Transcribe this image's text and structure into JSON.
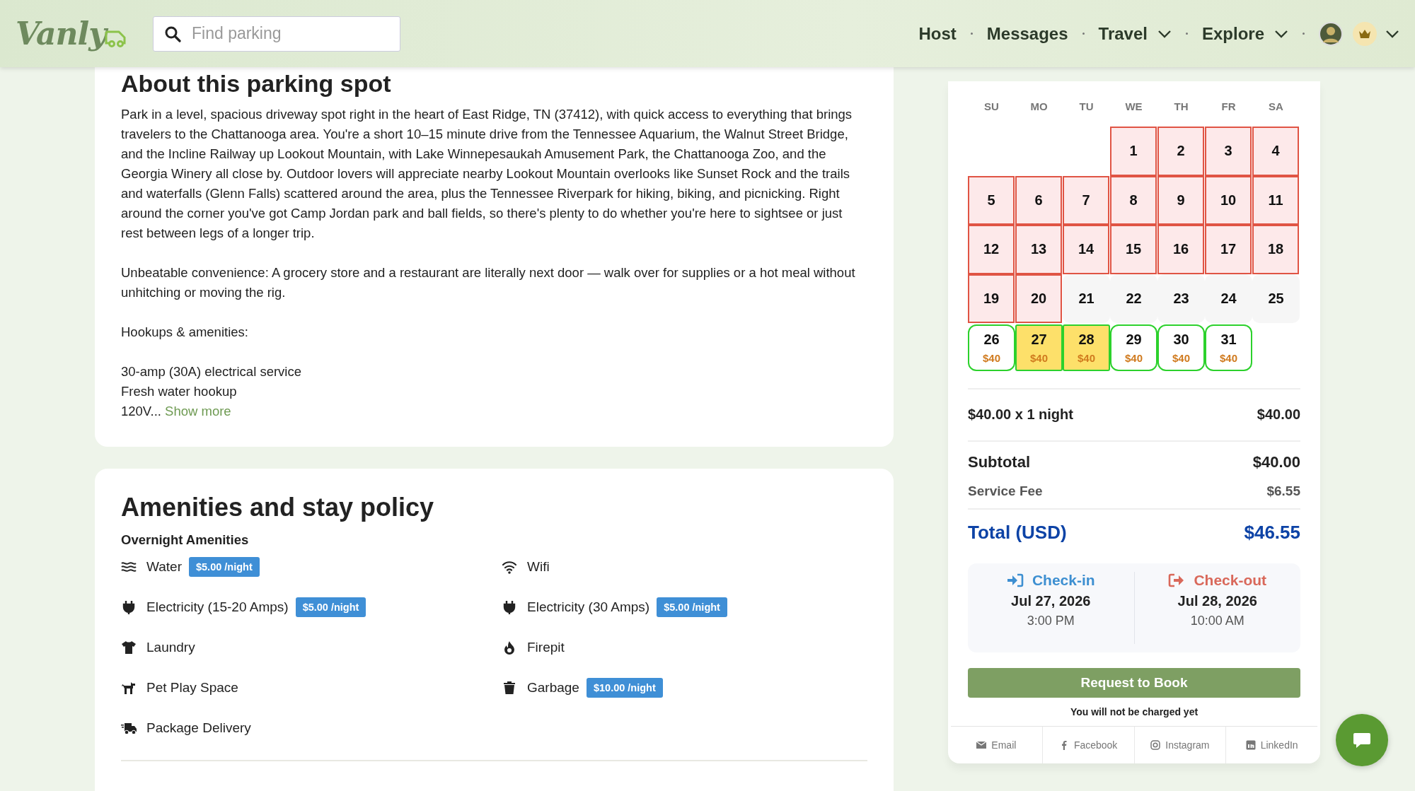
{
  "header": {
    "logo": "Vanly",
    "search": {
      "placeholder": "Find parking"
    },
    "nav": [
      {
        "label": "Host",
        "dropdown": false
      },
      {
        "label": "Messages",
        "dropdown": false
      },
      {
        "label": "Travel",
        "dropdown": true
      },
      {
        "label": "Explore",
        "dropdown": true
      }
    ]
  },
  "about": {
    "title": "About this parking spot",
    "paragraphs": [
      "Park in a level, spacious driveway spot right in the heart of East Ridge, TN (37412), with quick access to everything that brings travelers to the Chattanooga area. You're a short 10–15 minute drive from the Tennessee Aquarium, the Walnut Street Bridge, and the Incline Railway up Lookout Mountain, with Lake Winnepesaukah Amusement Park, the Chattanooga Zoo, and the Georgia Winery all close by. Outdoor lovers will appreciate nearby Lookout Mountain overlooks like Sunset Rock and the trails and waterfalls (Glenn Falls) scattered around the area, plus the Tennessee Riverpark for hiking, biking, and picnicking. Right around the corner you've got Camp Jordan park and ball fields, so there's plenty to do whether you're here to sightsee or just rest between legs of a longer trip.",
      "Unbeatable convenience: A grocery store and a restaurant are literally next door — walk over for supplies or a hot meal without unhitching or moving the rig.",
      "Hookups & amenities:"
    ],
    "list_lines": [
      "30-amp (30A) electrical service",
      "Fresh water hookup"
    ],
    "last_line": "120V...",
    "show_more": "Show more"
  },
  "amenities": {
    "title": "Amenities and stay policy",
    "section": "Overnight Amenities",
    "items": [
      {
        "kind": "water",
        "label": "Water",
        "fee": "$5.00 /night"
      },
      {
        "kind": "wifi",
        "label": "Wifi"
      },
      {
        "kind": "electricity",
        "label": "Electricity (15-20 Amps)",
        "fee": "$5.00 /night"
      },
      {
        "kind": "electricity",
        "label": "Electricity (30 Amps)",
        "fee": "$5.00 /night"
      },
      {
        "kind": "laundry",
        "label": "Laundry"
      },
      {
        "kind": "firepit",
        "label": "Firepit"
      },
      {
        "kind": "pets",
        "label": "Pet Play Space"
      },
      {
        "kind": "garbage",
        "label": "Garbage",
        "fee": "$10.00 /night"
      },
      {
        "kind": "delivery",
        "label": "Package Delivery"
      }
    ]
  },
  "booking": {
    "weekdays": [
      "SU",
      "MO",
      "TU",
      "WE",
      "TH",
      "FR",
      "SA"
    ],
    "days": [
      {
        "kind": "blank"
      },
      {
        "kind": "blank"
      },
      {
        "kind": "blank"
      },
      {
        "day": "1",
        "kind": "blocked",
        "selected": false
      },
      {
        "day": "2",
        "kind": "blocked",
        "selected": false
      },
      {
        "day": "3",
        "kind": "blocked",
        "selected": false
      },
      {
        "day": "4",
        "kind": "blocked",
        "selected": false
      },
      {
        "day": "5",
        "kind": "blocked",
        "selected": false
      },
      {
        "day": "6",
        "kind": "blocked",
        "selected": false
      },
      {
        "day": "7",
        "kind": "blocked",
        "selected": false
      },
      {
        "day": "8",
        "kind": "blocked",
        "selected": false
      },
      {
        "day": "9",
        "kind": "blocked",
        "selected": false
      },
      {
        "day": "10",
        "kind": "blocked",
        "selected": false
      },
      {
        "day": "11",
        "kind": "blocked",
        "selected": false
      },
      {
        "day": "12",
        "kind": "blocked",
        "selected": false
      },
      {
        "day": "13",
        "kind": "blocked",
        "selected": false
      },
      {
        "day": "14",
        "kind": "blocked",
        "selected": false
      },
      {
        "day": "15",
        "kind": "blocked",
        "selected": false
      },
      {
        "day": "16",
        "kind": "blocked",
        "selected": false
      },
      {
        "day": "17",
        "kind": "blocked",
        "selected": false
      },
      {
        "day": "18",
        "kind": "blocked",
        "selected": false
      },
      {
        "day": "19",
        "kind": "blocked",
        "selected": false
      },
      {
        "day": "20",
        "kind": "blocked",
        "selected": false
      },
      {
        "day": "21",
        "kind": "unavailable",
        "selected": false
      },
      {
        "day": "22",
        "kind": "unavailable",
        "selected": false
      },
      {
        "day": "23",
        "kind": "unavailable",
        "selected": false
      },
      {
        "day": "24",
        "kind": "unavailable",
        "selected": false
      },
      {
        "day": "25",
        "kind": "unavailable",
        "selected": false
      },
      {
        "day": "26",
        "kind": "available",
        "selected": false,
        "price": "$40"
      },
      {
        "day": "27",
        "kind": "available",
        "selected": true,
        "price": "$40"
      },
      {
        "day": "28",
        "kind": "available",
        "selected": true,
        "price": "$40"
      },
      {
        "day": "29",
        "kind": "available",
        "selected": false,
        "price": "$40"
      },
      {
        "day": "30",
        "kind": "available",
        "selected": false,
        "price": "$40"
      },
      {
        "day": "31",
        "kind": "available",
        "selected": false,
        "price": "$40"
      }
    ],
    "price_lines": [
      {
        "kind": "line",
        "label": "$40.00 x 1 night",
        "amount": "$40.00"
      },
      {
        "kind": "subtotal",
        "label": "Subtotal",
        "amount": "$40.00"
      },
      {
        "kind": "fee",
        "label": "Service Fee",
        "amount": "$6.55"
      },
      {
        "kind": "total",
        "label": "Total (USD)",
        "amount": "$46.55"
      }
    ],
    "checkin": {
      "label": "Check-in",
      "date": "Jul 27, 2026",
      "time": "3:00 PM"
    },
    "checkout": {
      "label": "Check-out",
      "date": "Jul 28, 2026",
      "time": "10:00 AM"
    },
    "book_button": "Request to Book",
    "note": "You will not be charged yet",
    "share": [
      {
        "kind": "email",
        "label": "Email"
      },
      {
        "kind": "facebook",
        "label": "Facebook"
      },
      {
        "kind": "instagram",
        "label": "Instagram"
      },
      {
        "kind": "linkedin",
        "label": "LinkedIn"
      }
    ]
  }
}
